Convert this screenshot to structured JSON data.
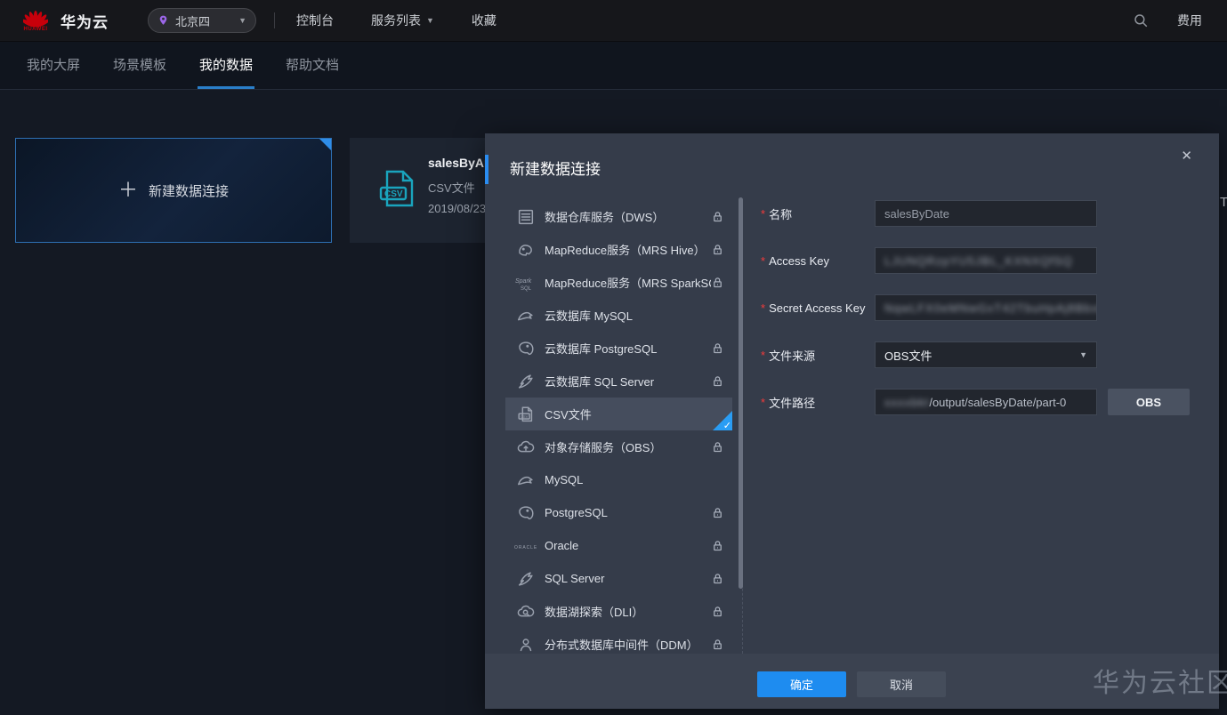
{
  "topnav": {
    "brand": "华为云",
    "logo_sub": "HUAWEI",
    "region": "北京四",
    "menu": [
      "控制台",
      "服务列表",
      "收藏"
    ],
    "billing": "费用"
  },
  "tabs": {
    "items": [
      {
        "label": "我的大屏",
        "active": false
      },
      {
        "label": "场景模板",
        "active": false
      },
      {
        "label": "我的数据",
        "active": true
      },
      {
        "label": "帮助文档",
        "active": false
      }
    ]
  },
  "cards": {
    "new_connection_label": "新建数据连接",
    "existing": {
      "title": "salesByAr",
      "type": "CSV文件",
      "date": "2019/08/23"
    }
  },
  "clipped_text_right": "T",
  "modal": {
    "title": "新建数据连接",
    "close": "✕",
    "datasources": [
      {
        "label": "数据仓库服务（DWS）",
        "icon": "dws",
        "locked": true,
        "selected": false
      },
      {
        "label": "MapReduce服务（MRS Hive）",
        "icon": "mrs-hive",
        "locked": true,
        "selected": false
      },
      {
        "label": "MapReduce服务（MRS SparkSQL）",
        "icon": "spark-sql",
        "locked": true,
        "selected": false
      },
      {
        "label": "云数据库 MySQL",
        "icon": "mysql",
        "locked": false,
        "selected": false
      },
      {
        "label": "云数据库 PostgreSQL",
        "icon": "postgresql",
        "locked": true,
        "selected": false
      },
      {
        "label": "云数据库 SQL Server",
        "icon": "sqlserver",
        "locked": true,
        "selected": false
      },
      {
        "label": "CSV文件",
        "icon": "csv",
        "locked": false,
        "selected": true
      },
      {
        "label": "对象存储服务（OBS）",
        "icon": "obs",
        "locked": true,
        "selected": false
      },
      {
        "label": "MySQL",
        "icon": "mysql",
        "locked": false,
        "selected": false
      },
      {
        "label": "PostgreSQL",
        "icon": "postgresql",
        "locked": true,
        "selected": false
      },
      {
        "label": "Oracle",
        "icon": "oracle",
        "locked": true,
        "selected": false
      },
      {
        "label": "SQL Server",
        "icon": "sqlserver",
        "locked": true,
        "selected": false
      },
      {
        "label": "数据湖探索（DLI）",
        "icon": "dli",
        "locked": true,
        "selected": false
      },
      {
        "label": "分布式数据库中间件（DDM）",
        "icon": "ddm",
        "locked": true,
        "selected": false
      }
    ],
    "form": {
      "name": {
        "label": "名称",
        "value": "salesByDate"
      },
      "access_key": {
        "label": "Access Key",
        "value_masked": "LJUNQRzpYU5JBL_KXNXQfSQ"
      },
      "secret_access_key": {
        "label": "Secret Access Key",
        "value_masked": "NqwLFX0eMNwGxT42TbuHpAj8BbxBxd"
      },
      "file_source": {
        "label": "文件来源",
        "value": "OBS文件"
      },
      "file_path": {
        "label": "文件路径",
        "masked_prefix": "xxxxbkt",
        "value": "/output/salesByDate/part-0",
        "button": "OBS"
      }
    },
    "footer": {
      "ok": "确定",
      "cancel": "取消"
    }
  },
  "watermark": "华为云社区"
}
